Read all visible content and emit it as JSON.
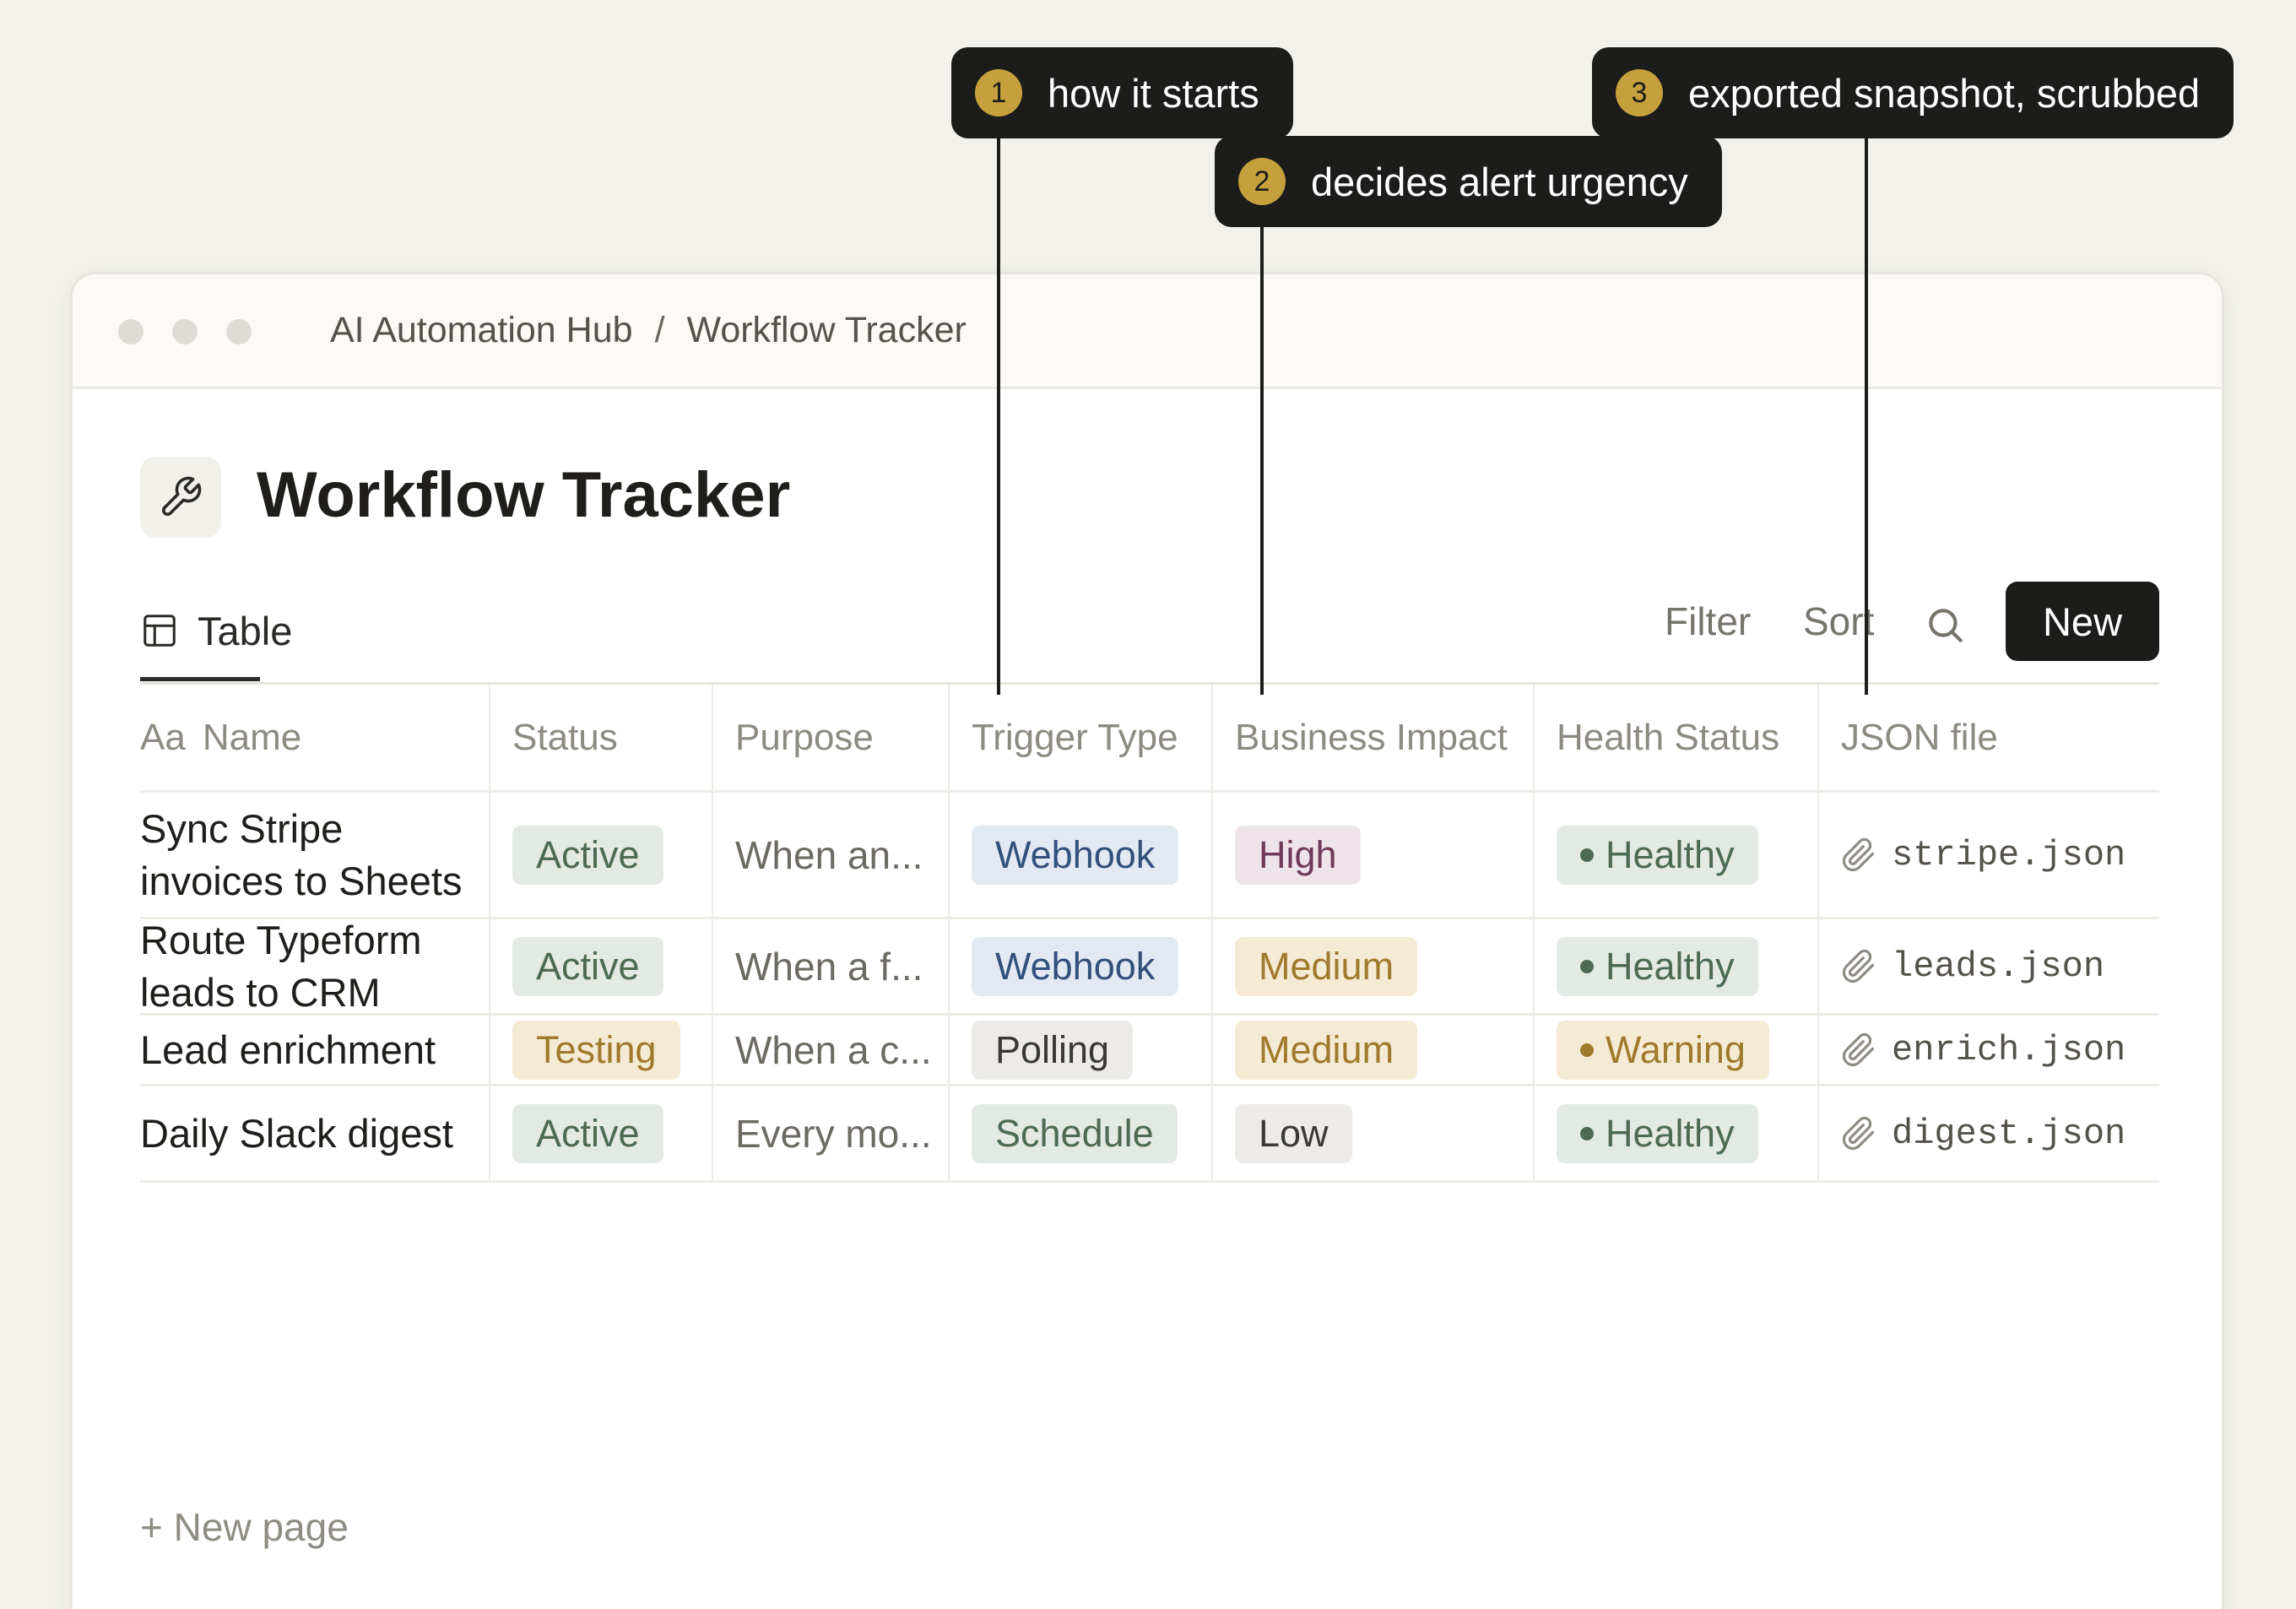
{
  "breadcrumb": {
    "parent": "AI Automation Hub",
    "separator": "/",
    "current": "Workflow Tracker"
  },
  "page": {
    "icon": "wrench-icon",
    "title": "Workflow Tracker"
  },
  "view": {
    "tab_label": "Table",
    "tab_icon": "table-icon"
  },
  "toolbar": {
    "filter_label": "Filter",
    "sort_label": "Sort",
    "search_icon": "search-icon",
    "new_label": "New"
  },
  "table": {
    "columns": {
      "name_prefix": "Aa",
      "name": "Name",
      "status": "Status",
      "purpose": "Purpose",
      "trigger": "Trigger Type",
      "impact": "Business Impact",
      "health": "Health Status",
      "file": "JSON file"
    },
    "rows": [
      {
        "name": "Sync Stripe invoices to Sheets",
        "status": "Active",
        "purpose": "When an...",
        "trigger": "Webhook",
        "impact": "High",
        "health": "Healthy",
        "file": "stripe.json"
      },
      {
        "name": "Route Typeform leads to CRM",
        "status": "Active",
        "purpose": "When a f...",
        "trigger": "Webhook",
        "impact": "Medium",
        "health": "Healthy",
        "file": "leads.json"
      },
      {
        "name": "Lead enrichment",
        "status": "Testing",
        "purpose": "When a c...",
        "trigger": "Polling",
        "impact": "Medium",
        "health": "Warning",
        "file": "enrich.json"
      },
      {
        "name": "Daily Slack digest",
        "status": "Active",
        "purpose": "Every mo...",
        "trigger": "Schedule",
        "impact": "Low",
        "health": "Healthy",
        "file": "digest.json"
      }
    ],
    "new_page_label": "+ New page"
  },
  "callouts": [
    {
      "number": "1",
      "text": "how it starts"
    },
    {
      "number": "2",
      "text": "decides alert urgency"
    },
    {
      "number": "3",
      "text": "exported snapshot, scrubbed"
    }
  ],
  "colors": {
    "status_active_bg": "#e3e9e3",
    "status_active_fg": "#4d6b52",
    "status_testing_bg": "#f5ead4",
    "status_testing_fg": "#a07a2c",
    "trigger_webhook_bg": "#e2e9f3",
    "trigger_webhook_fg": "#33507d",
    "trigger_polling_bg": "#ecebe7",
    "trigger_polling_fg": "#3a3935",
    "trigger_schedule_bg": "#e3e9e3",
    "trigger_schedule_fg": "#4d6b52",
    "impact_high_bg": "#efe3ea",
    "impact_high_fg": "#6e3a58",
    "impact_medium_bg": "#f5ead4",
    "impact_medium_fg": "#a07a2c",
    "impact_low_bg": "#ecebe7",
    "impact_low_fg": "#3a3935",
    "health_healthy_bg": "#e3e9e3",
    "health_healthy_fg": "#4d6b52",
    "health_warning_bg": "#f5ead4",
    "health_warning_fg": "#a07a2c",
    "callout_badge": "#c5a03c"
  }
}
